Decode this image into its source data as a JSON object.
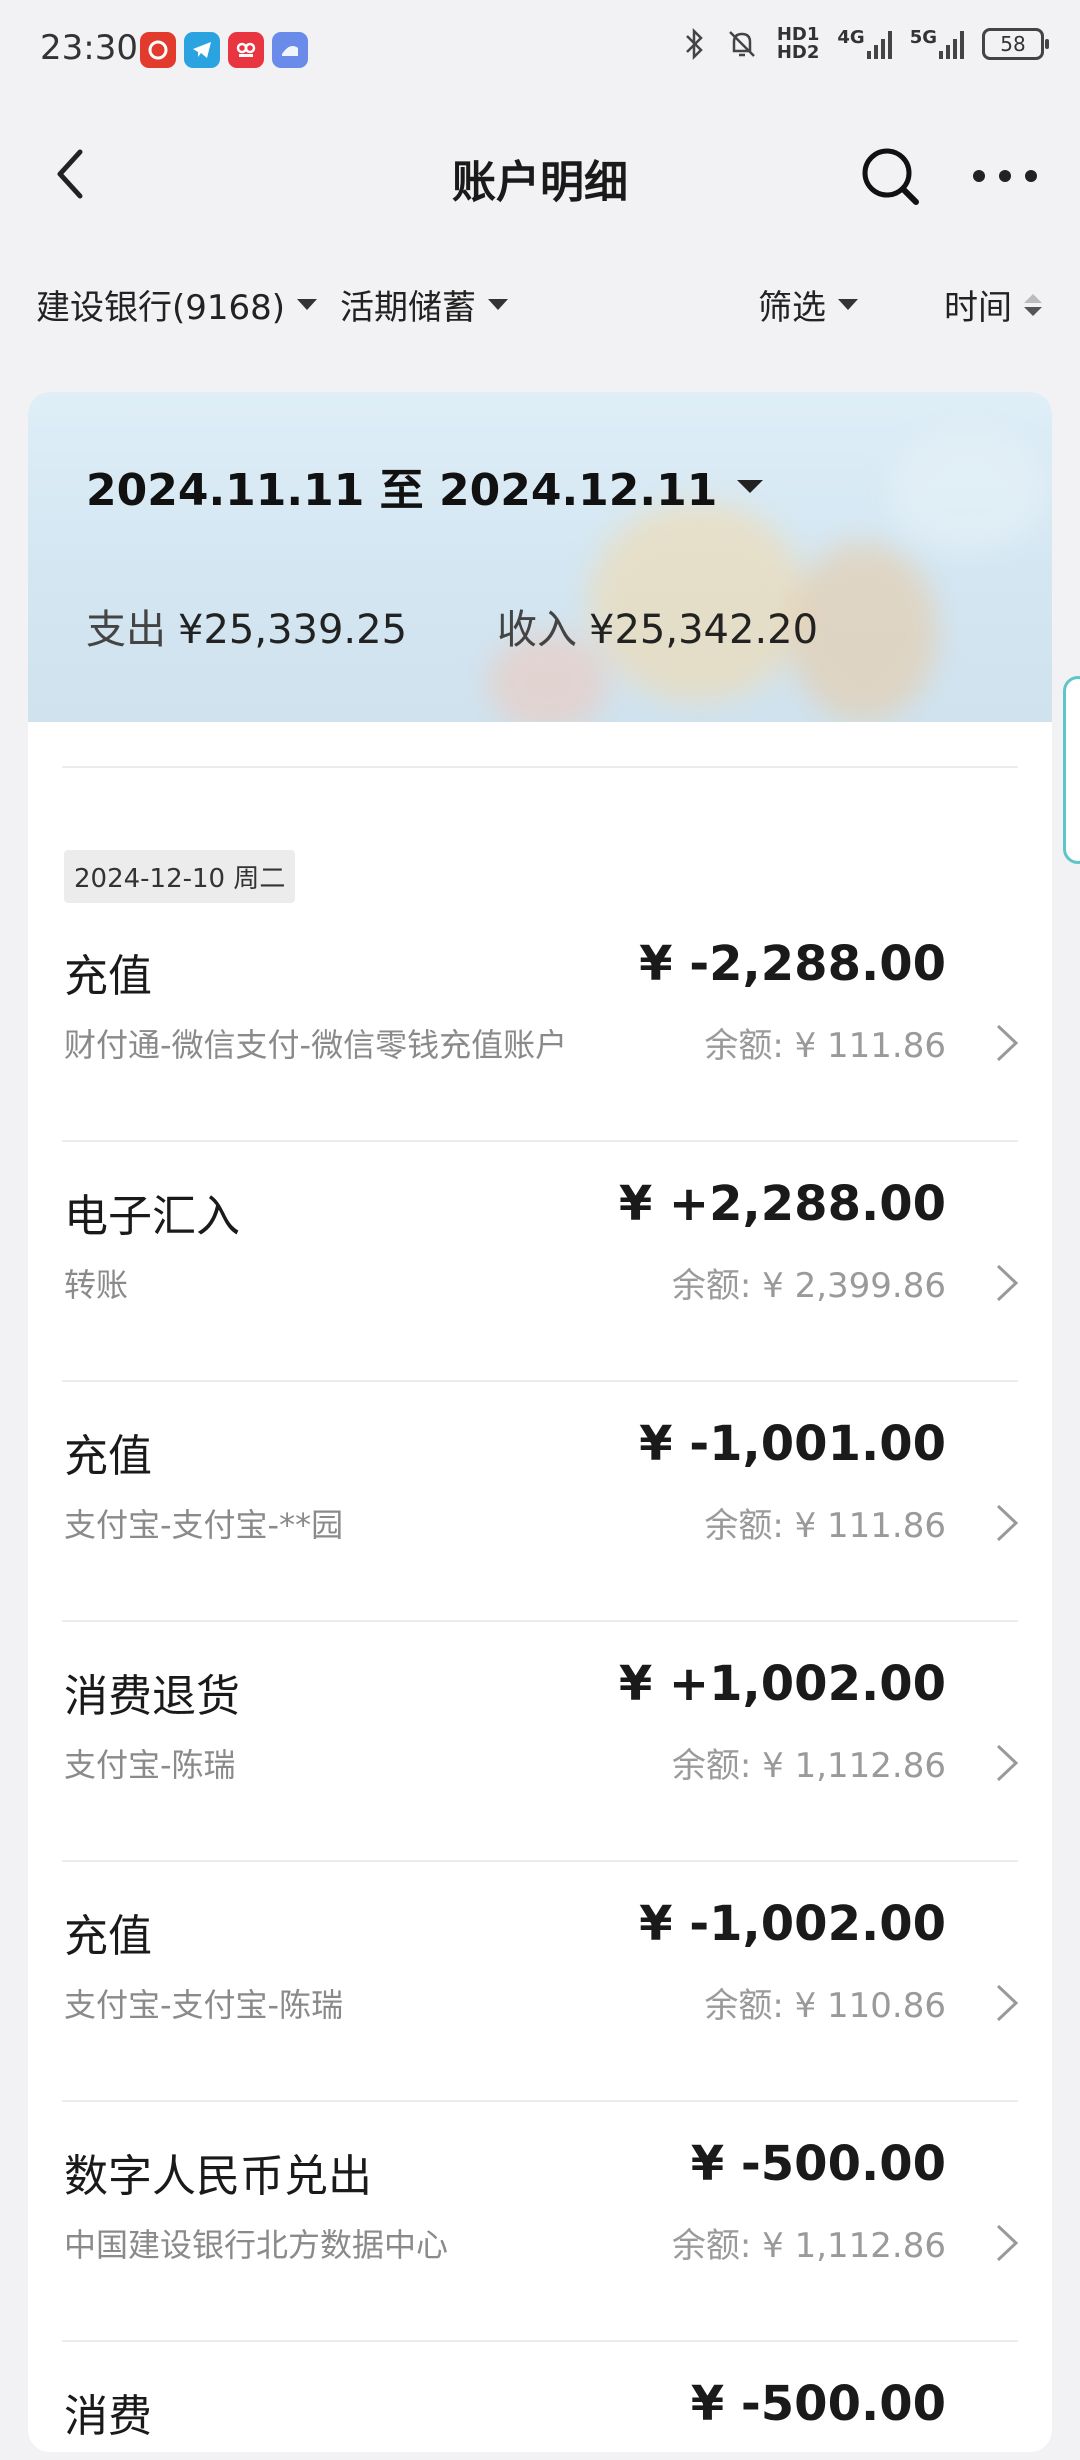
{
  "status_bar": {
    "time": "23:30",
    "apps": [
      {
        "icon": "netease-music-icon",
        "color": "#e23b2e"
      },
      {
        "icon": "telegram-icon",
        "color": "#2aa3e0"
      },
      {
        "icon": "app-red-icon",
        "color": "#e8353f"
      },
      {
        "icon": "app-blue-icon",
        "color": "#6a8bea"
      }
    ],
    "hd1": "HD1",
    "hd2": "HD2",
    "net_4g": "4G",
    "net_5g": "5G",
    "battery": "58"
  },
  "nav": {
    "title": "账户明细"
  },
  "filters": {
    "bank": "建设银行(9168)",
    "account_type": "活期储蓄",
    "filter": "筛选",
    "time": "时间"
  },
  "summary": {
    "date_range": "2024.11.11 至 2024.12.11",
    "expense_label": "支出",
    "expense_value": "¥25,339.25",
    "income_label": "收入",
    "income_value": "¥25,342.20"
  },
  "date_tag": "2024-12-10 周二",
  "transactions": [
    {
      "name": "充值",
      "desc": "财付通-微信支付-微信零钱充值账户",
      "amount": "¥ -2,288.00",
      "balance": "余额: ¥ 111.86"
    },
    {
      "name": "电子汇入",
      "desc": "转账",
      "amount": "¥ +2,288.00",
      "balance": "余额: ¥ 2,399.86"
    },
    {
      "name": "充值",
      "desc": "支付宝-支付宝-**园",
      "amount": "¥ -1,001.00",
      "balance": "余额: ¥ 111.86"
    },
    {
      "name": "消费退货",
      "desc": "支付宝-陈瑞",
      "amount": "¥ +1,002.00",
      "balance": "余额: ¥ 1,112.86"
    },
    {
      "name": "充值",
      "desc": "支付宝-支付宝-陈瑞",
      "amount": "¥ -1,002.00",
      "balance": "余额: ¥ 110.86"
    },
    {
      "name": "数字人民币兑出",
      "desc": "中国建设银行北方数据中心",
      "amount": "¥ -500.00",
      "balance": "余额: ¥ 1,112.86"
    },
    {
      "name": "消费",
      "desc": "",
      "amount": "¥ -500.00",
      "balance": ""
    }
  ]
}
